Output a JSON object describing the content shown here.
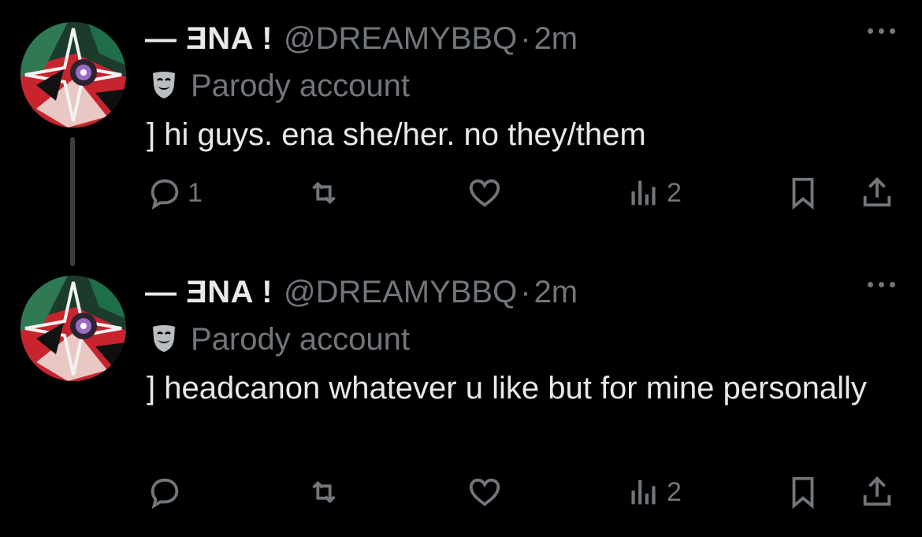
{
  "tweets": [
    {
      "display_name": "— ƎNA !",
      "handle": "@DREAMYBBQ",
      "separator": "·",
      "time": "2m",
      "label": "Parody account",
      "label_icon": "theater-mask-icon",
      "text": "]  hi guys. ena she/her. no they/them",
      "reply_count": "1",
      "repost_count": "",
      "like_count": "",
      "view_count": "2"
    },
    {
      "display_name": "— ƎNA !",
      "handle": "@DREAMYBBQ",
      "separator": "·",
      "time": "2m",
      "label": "Parody account",
      "label_icon": "theater-mask-icon",
      "text": "]  headcanon whatever u like but for mine personally",
      "reply_count": "",
      "repost_count": "",
      "like_count": "",
      "view_count": "2"
    }
  ],
  "colors": {
    "background": "#000000",
    "primary_text": "#e7e9ea",
    "secondary_text": "#71767b",
    "thread_line": "#3a3d42"
  },
  "icons": [
    "reply-icon",
    "repost-icon",
    "like-icon",
    "views-icon",
    "bookmark-icon",
    "share-icon",
    "more-icon"
  ]
}
